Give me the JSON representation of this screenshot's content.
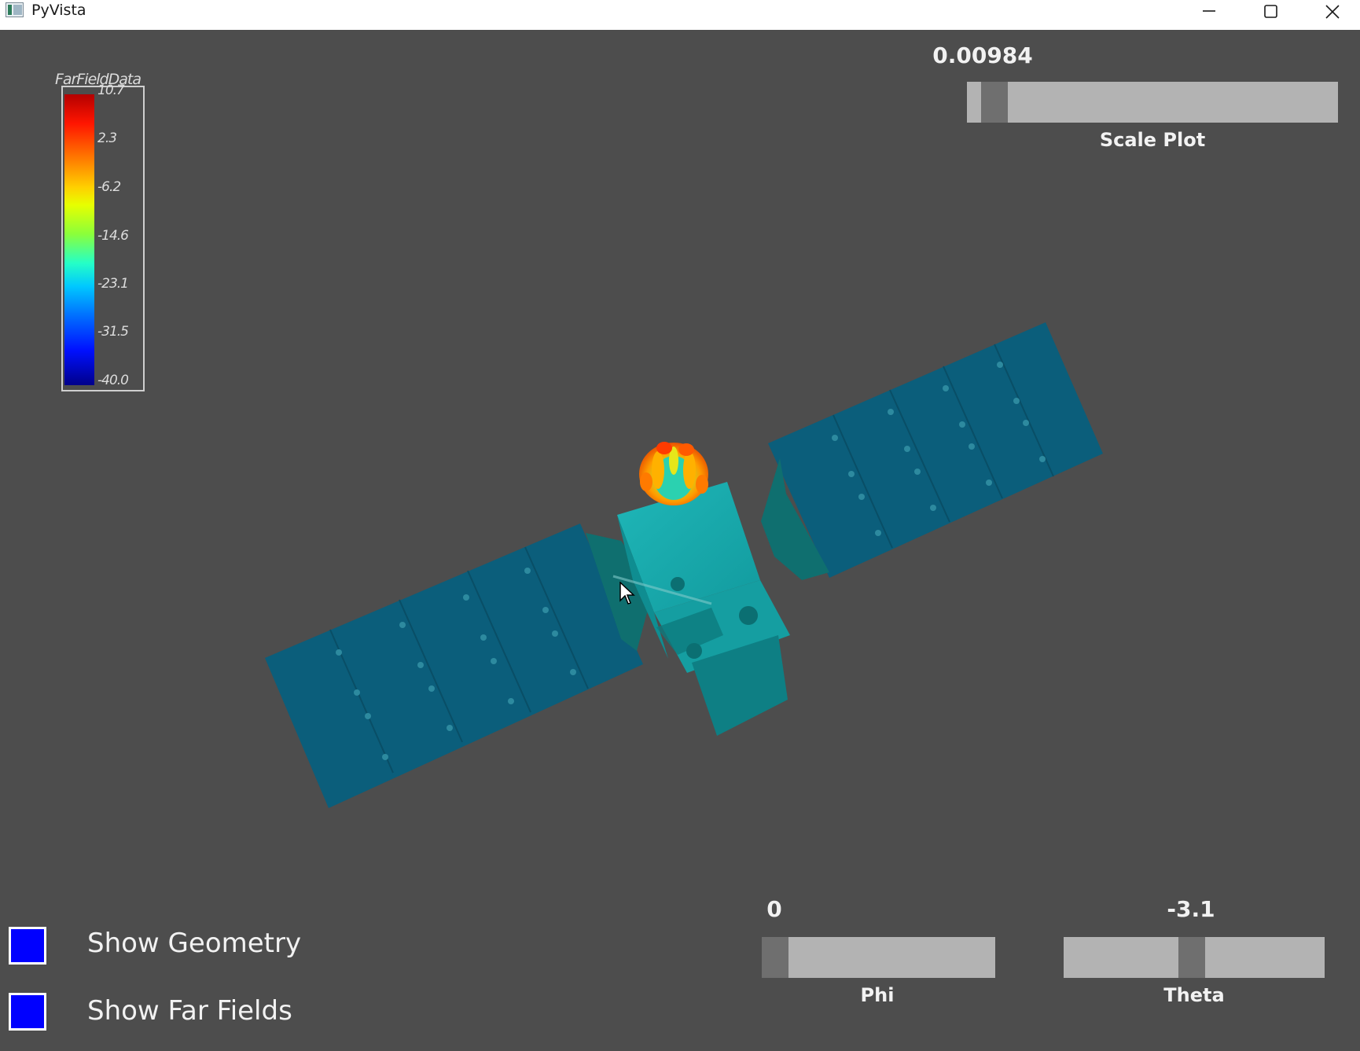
{
  "window": {
    "title": "PyVista"
  },
  "colors": {
    "background": "#4d4d4d",
    "panel_blue": "#0b5b78",
    "body_teal": "#17a3a8",
    "checkbox_fill": "#0000ff",
    "slider_track": "#b3b3b3",
    "slider_thumb": "#6f6f6f"
  },
  "scalar_bar": {
    "title": "FarFieldData",
    "ticks": [
      "10.7",
      "2.3",
      "-6.2",
      "-14.6",
      "-23.1",
      "-31.5",
      "-40.0"
    ],
    "colormap": "jet"
  },
  "sliders": {
    "scale": {
      "label": "Scale Plot",
      "value_text": "0.00984",
      "fraction": 0.04
    },
    "phi": {
      "label": "Phi",
      "value_text": "0",
      "fraction": 0.0
    },
    "theta": {
      "label": "Theta",
      "value_text": "-3.1",
      "fraction": 0.49
    }
  },
  "checkboxes": {
    "geometry": {
      "label": "Show Geometry",
      "checked": true
    },
    "far_fields": {
      "label": "Show Far Fields",
      "checked": true
    }
  },
  "scene": {
    "object": "satellite",
    "overlay": "far-field radiation pattern"
  }
}
